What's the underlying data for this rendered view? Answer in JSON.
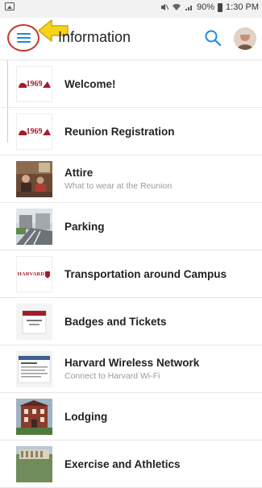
{
  "status_bar": {
    "battery": "90%",
    "time": "1:30 PM",
    "icons": [
      "gallery-icon",
      "mute-icon",
      "wifi-icon",
      "signal-icon",
      "battery-icon"
    ]
  },
  "app_bar": {
    "title": "Information",
    "menu_icon": "hamburger-menu-icon",
    "search_icon": "search-icon",
    "annotation": {
      "circle_color": "#c0392b",
      "arrow_color": "#f5c400"
    },
    "accent_color": "#1e88e5"
  },
  "list": {
    "items": [
      {
        "title": "Welcome!",
        "subtitle": "",
        "thumb_text": "1969"
      },
      {
        "title": "Reunion Registration",
        "subtitle": "",
        "thumb_text": "1969"
      },
      {
        "title": "Attire",
        "subtitle": "What to wear at the Reunion"
      },
      {
        "title": "Parking",
        "subtitle": ""
      },
      {
        "title": "Transportation around Campus",
        "subtitle": "",
        "thumb_text": "HARVARD"
      },
      {
        "title": "Badges and Tickets",
        "subtitle": ""
      },
      {
        "title": "Harvard Wireless Network",
        "subtitle": "Connect to Harvard Wi-Fi"
      },
      {
        "title": "Lodging",
        "subtitle": ""
      },
      {
        "title": "Exercise and Athletics",
        "subtitle": ""
      }
    ]
  }
}
